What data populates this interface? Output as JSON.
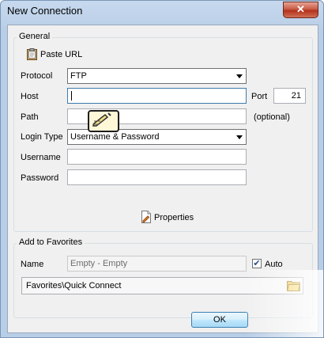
{
  "window": {
    "title": "New Connection",
    "close_symbol": "✕"
  },
  "general": {
    "group_title": "General",
    "paste_url_label": "Paste URL",
    "protocol": {
      "label": "Protocol",
      "value": "FTP"
    },
    "host": {
      "label": "Host",
      "value": ""
    },
    "port": {
      "label": "Port",
      "value": "21"
    },
    "path": {
      "label": "Path",
      "value": "",
      "hint": "(optional)"
    },
    "login_type": {
      "label": "Login Type",
      "value": "Username & Password"
    },
    "username": {
      "label": "Username",
      "value": ""
    },
    "password": {
      "label": "Password",
      "value": ""
    },
    "properties_label": "Properties"
  },
  "favorites": {
    "group_title": "Add to Favorites",
    "name_label": "Name",
    "name_value": "Empty - Empty",
    "auto_label": "Auto",
    "auto_checked": true,
    "folder_path": "Favorites\\Quick Connect"
  },
  "buttons": {
    "ok_label": "OK"
  },
  "icons": {
    "paste": "clipboard-icon",
    "properties": "properties-document-icon",
    "folder": "folder-icon",
    "tooltip": "pen-edit-icon"
  }
}
